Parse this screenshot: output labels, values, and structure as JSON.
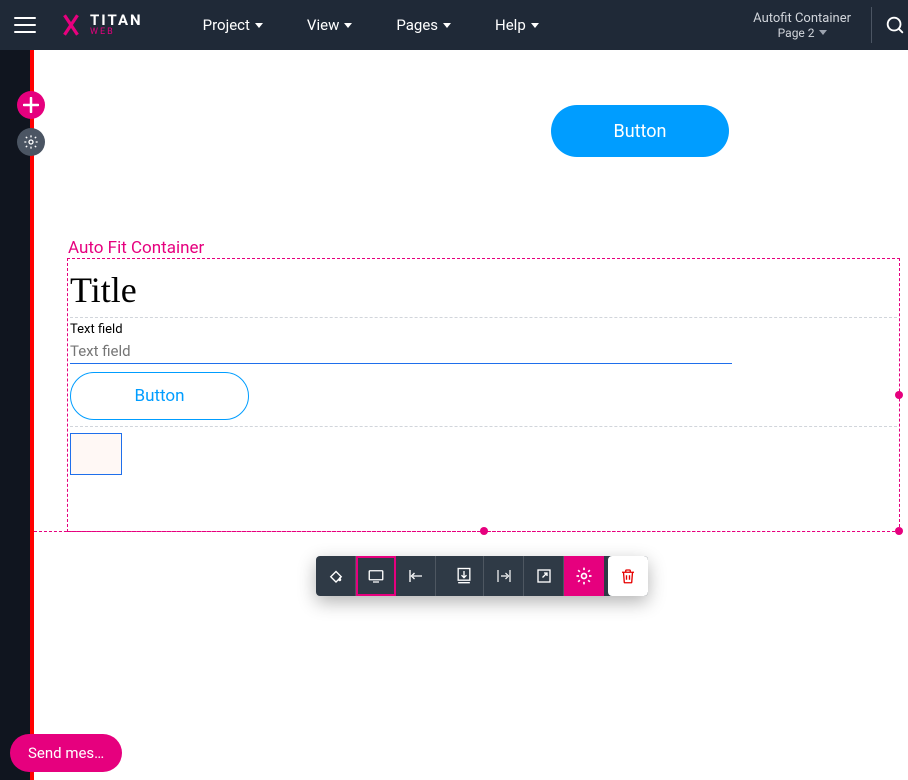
{
  "brand": {
    "name": "TITAN",
    "sub": "WEB"
  },
  "menu": {
    "project": "Project",
    "view": "View",
    "pages": "Pages",
    "help": "Help"
  },
  "breadcrumb": {
    "top": "Autofit Container",
    "bottom": "Page 2"
  },
  "canvas": {
    "top_button_label": "Button",
    "container_label": "Auto Fit Container",
    "title": "Title",
    "field_label": "Text field",
    "field_placeholder": "Text field",
    "inner_button_label": "Button"
  },
  "chat": {
    "label": "Send mes…"
  }
}
